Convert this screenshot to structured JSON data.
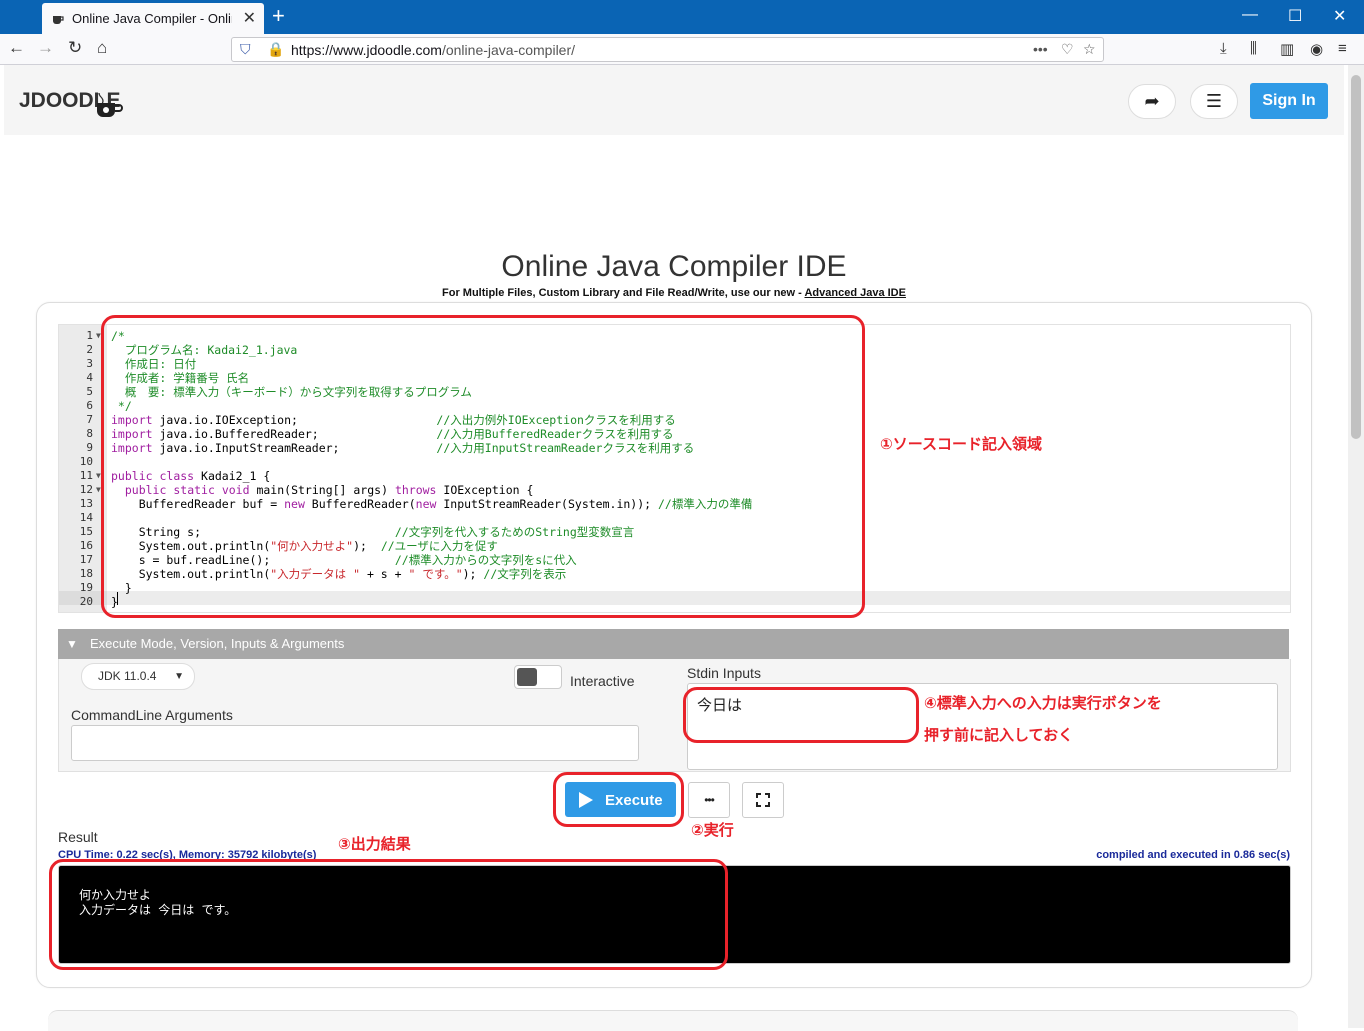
{
  "browser": {
    "tab_title": "Online Java Compiler - Online J",
    "url_domain": "https://www.jdoodle.com",
    "url_path": "/online-java-compiler/"
  },
  "header": {
    "logo_text": "JDOODLE",
    "sign_in": "Sign In"
  },
  "page": {
    "title": "Online Java Compiler IDE",
    "subtitle_prefix": "For Multiple Files, Custom Library and File Read/Write, use our new - ",
    "subtitle_link": "Advanced Java IDE"
  },
  "editor": {
    "lines": [
      {
        "n": "1",
        "text": "/*"
      },
      {
        "n": "2",
        "text": "  プログラム名: Kadai2_1.java"
      },
      {
        "n": "3",
        "text": "  作成日: 日付"
      },
      {
        "n": "4",
        "text": "  作成者: 学籍番号 氏名"
      },
      {
        "n": "5",
        "text": "  概　要: 標準入力（キーボード）から文字列を取得するプログラム"
      },
      {
        "n": "6",
        "text": " */"
      },
      {
        "n": "7",
        "text": "import java.io.IOException;                    //入出力例外IOExceptionクラスを利用する"
      },
      {
        "n": "8",
        "text": "import java.io.BufferedReader;                 //入力用BufferedReaderクラスを利用する"
      },
      {
        "n": "9",
        "text": "import java.io.InputStreamReader;              //入力用InputStreamReaderクラスを利用する"
      },
      {
        "n": "10",
        "text": ""
      },
      {
        "n": "11",
        "text": "public class Kadai2_1 {"
      },
      {
        "n": "12",
        "text": "  public static void main(String[] args) throws IOException {"
      },
      {
        "n": "13",
        "text": "    BufferedReader buf = new BufferedReader(new InputStreamReader(System.in)); //標準入力の準備"
      },
      {
        "n": "14",
        "text": ""
      },
      {
        "n": "15",
        "text": "    String s;                            //文字列を代入するためのString型変数宣言"
      },
      {
        "n": "16",
        "text": "    System.out.println(\"何か入力せよ\");  //ユーザに入力を促す"
      },
      {
        "n": "17",
        "text": "    s = buf.readLine();                  //標準入力からの文字列をsに代入"
      },
      {
        "n": "18",
        "text": "    System.out.println(\"入力データは \" + s + \" です。\"); //文字列を表示"
      },
      {
        "n": "19",
        "text": "  }"
      },
      {
        "n": "20",
        "text": "}"
      }
    ]
  },
  "execute_section": {
    "header": "Execute Mode, Version, Inputs & Arguments",
    "jdk_version": "JDK 11.0.4",
    "interactive_label": "Interactive",
    "stdin_label": "Stdin Inputs",
    "stdin_value": "今日は",
    "args_label": "CommandLine Arguments",
    "args_value": ""
  },
  "actions": {
    "execute": "Execute",
    "more": "•••"
  },
  "result": {
    "label": "Result",
    "cpu_time": "CPU Time: 0.22 sec(s), Memory: 35792 kilobyte(s)",
    "compiled": "compiled and executed in 0.86 sec(s)",
    "output_line1": "何か入力せよ",
    "output_line2": "入力データは 今日は です。"
  },
  "annotations": {
    "a1": "①ソースコード記入領域",
    "a2": "②実行",
    "a3": "③出力結果",
    "a4_line1": "④標準入力への入力は実行ボタンを",
    "a4_line2": "押す前に記入しておく"
  },
  "colors": {
    "accent_blue": "#2f9ae6",
    "annotation_red": "#e8222a",
    "browser_tabbar": "#0a64b4"
  }
}
